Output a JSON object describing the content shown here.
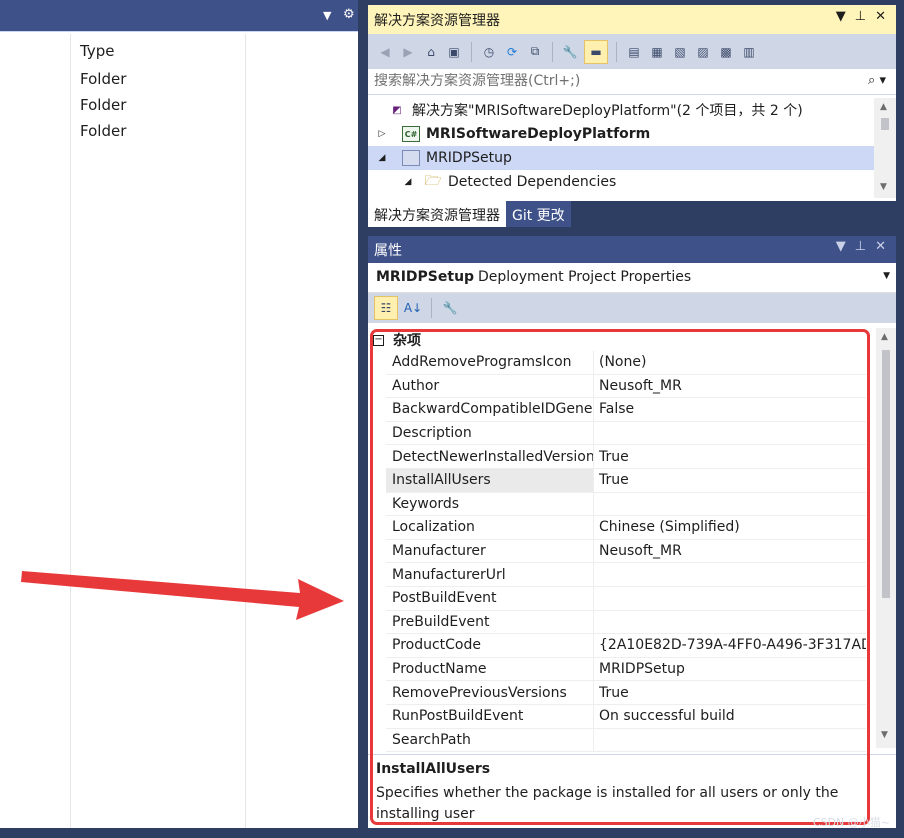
{
  "left_pane": {
    "column_header": "Type",
    "rows": [
      "Folder",
      "Folder",
      "Folder"
    ],
    "header_icons": [
      "dropdown-arrow-icon",
      "gear-icon"
    ]
  },
  "solution_explorer": {
    "title": "解决方案资源管理器",
    "search_placeholder": "搜索解决方案资源管理器(Ctrl+;)",
    "tree": [
      {
        "label": "解决方案\"MRISoftwareDeployPlatform\"(2 个项目，共 2 个)",
        "icon": "solution-icon"
      },
      {
        "label": "MRISoftwareDeployPlatform",
        "icon": "csharp-project-icon"
      },
      {
        "label": "MRIDPSetup",
        "icon": "setup-project-icon"
      },
      {
        "label": "Detected Dependencies",
        "icon": "folder-icon"
      }
    ],
    "tabs": [
      "解决方案资源管理器",
      "Git 更改"
    ]
  },
  "properties": {
    "title": "属性",
    "object_name": "MRIDPSetup",
    "object_type": "Deployment Project Properties",
    "category": "杂项",
    "rows": [
      {
        "name": "AddRemoveProgramsIcon",
        "value": "(None)"
      },
      {
        "name": "Author",
        "value": "Neusoft_MR"
      },
      {
        "name": "BackwardCompatibleIDGeneration",
        "value": "False"
      },
      {
        "name": "Description",
        "value": ""
      },
      {
        "name": "DetectNewerInstalledVersion",
        "value": "True"
      },
      {
        "name": "InstallAllUsers",
        "value": "True"
      },
      {
        "name": "Keywords",
        "value": ""
      },
      {
        "name": "Localization",
        "value": "Chinese (Simplified)"
      },
      {
        "name": "Manufacturer",
        "value": "Neusoft_MR"
      },
      {
        "name": "ManufacturerUrl",
        "value": ""
      },
      {
        "name": "PostBuildEvent",
        "value": ""
      },
      {
        "name": "PreBuildEvent",
        "value": ""
      },
      {
        "name": "ProductCode",
        "value": "{2A10E82D-739A-4FF0-A496-3F317AD"
      },
      {
        "name": "ProductName",
        "value": "MRIDPSetup"
      },
      {
        "name": "RemovePreviousVersions",
        "value": "True"
      },
      {
        "name": "RunPostBuildEvent",
        "value": "On successful build"
      },
      {
        "name": "SearchPath",
        "value": ""
      }
    ],
    "selected_row": "InstallAllUsers",
    "description_title": "InstallAllUsers",
    "description_text": "Specifies whether the package is installed for all users or only the installing user"
  },
  "watermark": "CSDN @小猫~",
  "colors": {
    "highlight_red": "#e8393a",
    "title_active": "#fff4b9",
    "title_inactive": "#3f5189",
    "frame": "#2e3e63"
  }
}
